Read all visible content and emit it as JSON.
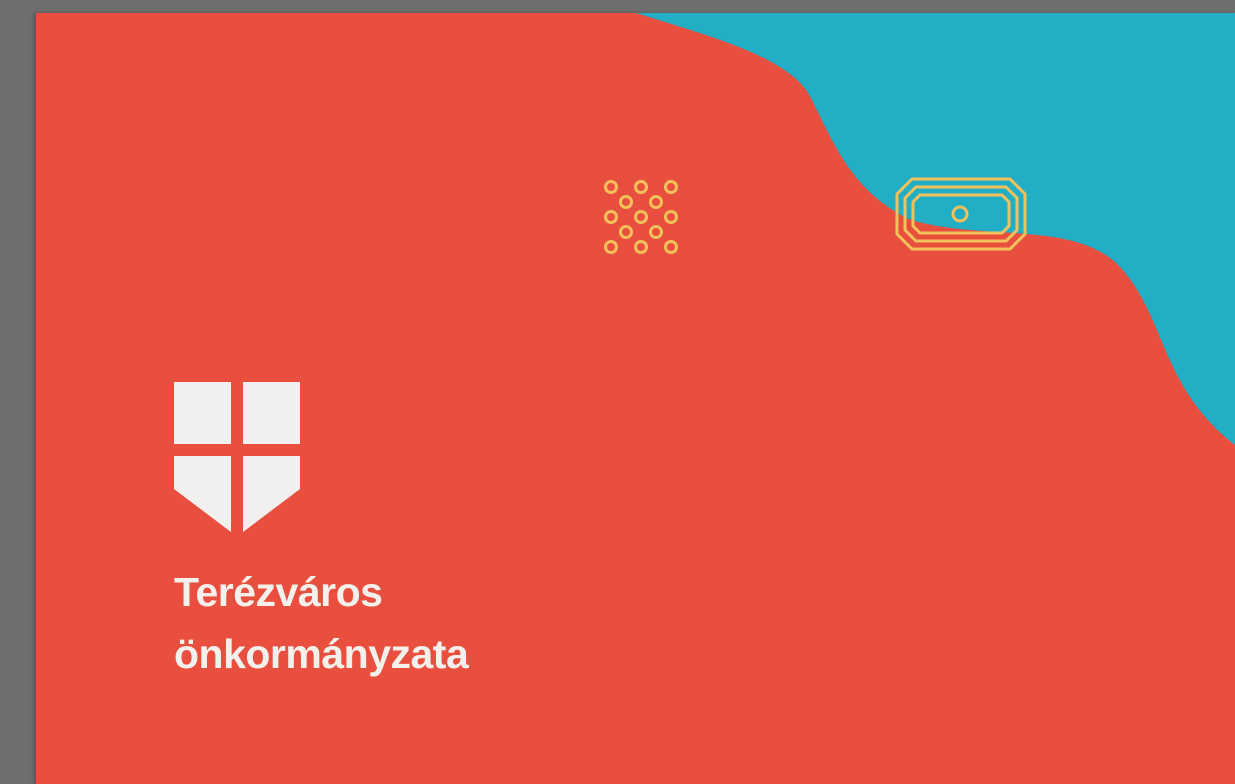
{
  "organization": {
    "name_line1": "Terézváros",
    "name_line2": "önkormányzata"
  },
  "colors": {
    "background": "#6f6f6f",
    "card_red": "#e84f3e",
    "card_teal": "#22aec4",
    "emblem_white": "#f2f0ee",
    "ornament_gold": "#f2c15a"
  },
  "icons": {
    "emblem": "shield-cross-icon",
    "pattern": "circle-lattice-icon",
    "plaque": "octagonal-frame-icon"
  }
}
